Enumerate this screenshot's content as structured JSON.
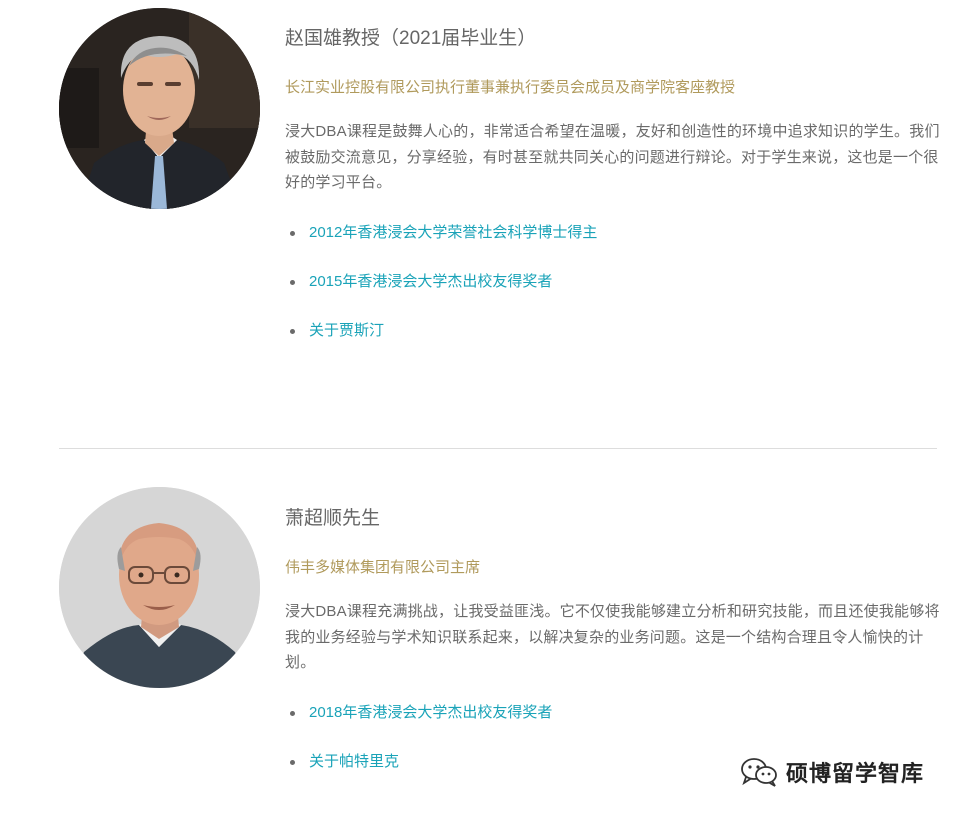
{
  "profiles": [
    {
      "name": "赵国雄教授（2021届毕业生）",
      "title": "长江实业控股有限公司执行董事兼执行委员会成员及商学院客座教授",
      "quote": "浸大DBA课程是鼓舞人心的，非常适合希望在温暖，友好和创造性的环境中追求知识的学生。我们被鼓励交流意见，分享经验，有时甚至就共同关心的问题进行辩论。对于学生来说，这也是一个很好的学习平台。",
      "links": [
        "2012年香港浸会大学荣誉社会科学博士得主",
        "2015年香港浸会大学杰出校友得奖者",
        "关于贾斯汀"
      ]
    },
    {
      "name": "萧超顺先生",
      "title": "伟丰多媒体集团有限公司主席",
      "quote": "浸大DBA课程充满挑战，让我受益匪浅。它不仅使我能够建立分析和研究技能，而且还使我能够将我的业务经验与学术知识联系起来，以解决复杂的业务问题。这是一个结构合理且令人愉快的计划。",
      "links": [
        "2018年香港浸会大学杰出校友得奖者",
        "关于帕特里克"
      ]
    }
  ],
  "watermark": {
    "text": "硕博留学智库",
    "icon": "wechat-icon"
  },
  "colors": {
    "name": "#666666",
    "title": "#b09a5c",
    "body": "#6a6a6a",
    "link": "#1aa3b8",
    "divider": "#dddddd"
  }
}
